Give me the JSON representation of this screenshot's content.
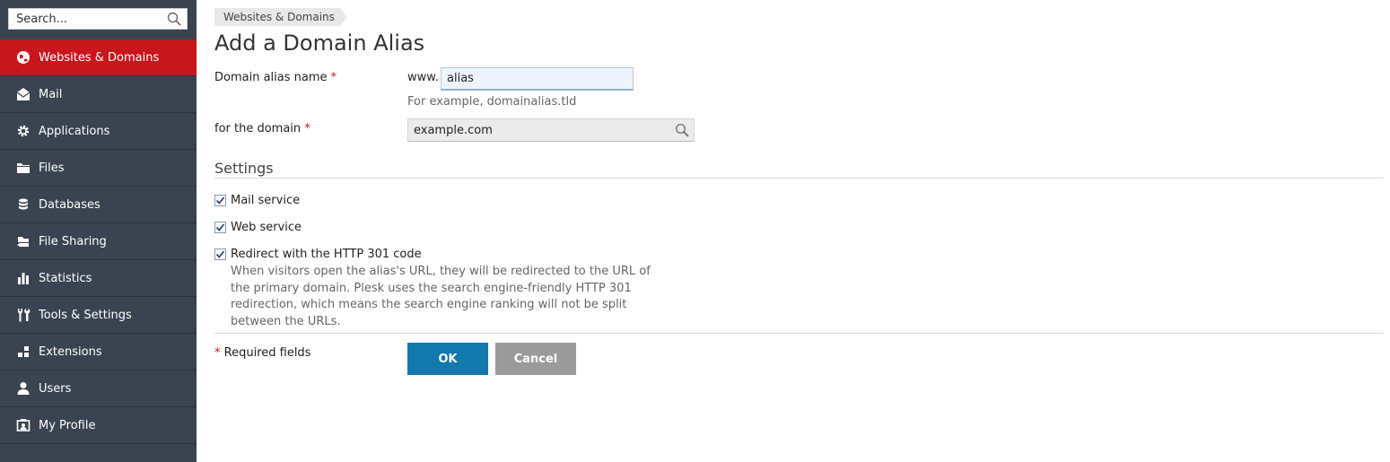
{
  "sidebar": {
    "search_placeholder": "Search...",
    "items": [
      {
        "label": "Websites & Domains",
        "icon": "globe-icon",
        "active": true
      },
      {
        "label": "Mail",
        "icon": "mail-icon"
      },
      {
        "label": "Applications",
        "icon": "gear-icon"
      },
      {
        "label": "Files",
        "icon": "folder-icon"
      },
      {
        "label": "Databases",
        "icon": "database-icon"
      },
      {
        "label": "File Sharing",
        "icon": "file-sharing-icon"
      },
      {
        "label": "Statistics",
        "icon": "bar-chart-icon"
      },
      {
        "label": "Tools & Settings",
        "icon": "tools-icon"
      },
      {
        "label": "Extensions",
        "icon": "extensions-icon"
      },
      {
        "label": "Users",
        "icon": "user-icon"
      },
      {
        "label": "My Profile",
        "icon": "profile-icon"
      }
    ]
  },
  "breadcrumb": {
    "item": "Websites & Domains"
  },
  "page": {
    "title": "Add a Domain Alias"
  },
  "form": {
    "alias_label": "Domain alias name",
    "required_mark": "*",
    "www_prefix": "www.",
    "alias_value": "alias",
    "alias_hint": "For example, domainalias.tld",
    "domain_label": "for the domain",
    "domain_value": "example.com"
  },
  "settings": {
    "title": "Settings",
    "mail_service": {
      "label": "Mail service",
      "checked": true
    },
    "web_service": {
      "label": "Web service",
      "checked": true
    },
    "redirect": {
      "label": "Redirect with the HTTP 301 code",
      "checked": true
    },
    "redirect_desc": "When visitors open the alias's URL, they will be redirected to the URL of the primary domain. Plesk uses the search engine-friendly HTTP 301 redirection, which means the search engine ranking will not be split between the URLs."
  },
  "footer": {
    "required_mark": "*",
    "required_note": "Required fields",
    "ok_label": "OK",
    "cancel_label": "Cancel"
  },
  "colors": {
    "sidebar_bg": "#3a4450",
    "active_item": "#c8161d",
    "ok_button": "#1179ab",
    "cancel_button": "#9a9a9a"
  }
}
